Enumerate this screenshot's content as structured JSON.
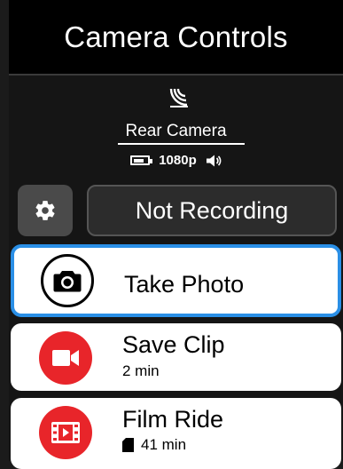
{
  "header": {
    "title": "Camera Controls"
  },
  "camera": {
    "name": "Rear Camera",
    "resolution": "1080p",
    "battery_icon": "battery-icon",
    "signal_icon": "radar-signal-icon",
    "sound_icon": "speaker-icon"
  },
  "controls": {
    "settings_icon": "gear-icon",
    "record_status": "Not Recording"
  },
  "actions": [
    {
      "title": "Take Photo",
      "icon": "camera-icon",
      "selected": true
    },
    {
      "title": "Save Clip",
      "subtitle": "2 min",
      "icon": "video-icon"
    },
    {
      "title": "Film Ride",
      "subtitle": "41 min",
      "icon": "film-icon",
      "sub_icon": "sd-card-icon"
    }
  ],
  "colors": {
    "accent": "#2a8fe6",
    "red": "#e8252a",
    "header_bg": "#000000"
  }
}
